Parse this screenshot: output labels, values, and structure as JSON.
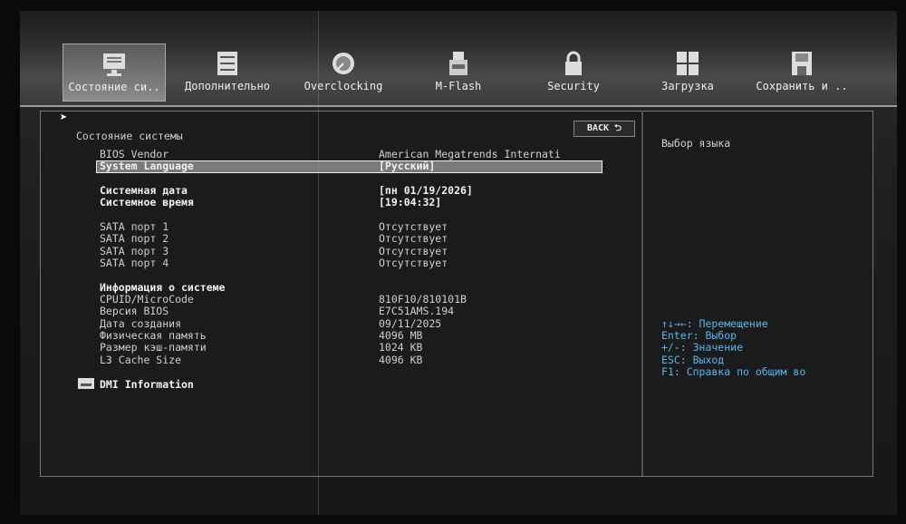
{
  "tabs": [
    {
      "label": "Состояние си..",
      "icon": "monitor-icon",
      "active": true
    },
    {
      "label": "Дополнительно",
      "icon": "settings-sliders-icon"
    },
    {
      "label": "Overclocking",
      "icon": "gauge-icon"
    },
    {
      "label": "M-Flash",
      "icon": "usb-flash-icon"
    },
    {
      "label": "Security",
      "icon": "lock-icon"
    },
    {
      "label": "Загрузка",
      "icon": "boot-icon"
    },
    {
      "label": "Сохранить и ..",
      "icon": "floppy-icon"
    }
  ],
  "main": {
    "title": "Состояние системы",
    "back_label": "BACK ⮌",
    "rows": [
      {
        "label": "BIOS Vendor",
        "value": "American Megatrends Internati"
      },
      {
        "label": "System Language",
        "value": "[Русский]"
      },
      {
        "label": "Системная дата",
        "value": "[пн 01/19/2026]"
      },
      {
        "label": "Системное время",
        "value": "[19:04:32]"
      },
      {
        "label": "SATA порт 1",
        "value": "Отсутствует"
      },
      {
        "label": "SATA порт 2",
        "value": "Отсутствует"
      },
      {
        "label": "SATA порт 3",
        "value": "Отсутствует"
      },
      {
        "label": "SATA порт 4",
        "value": "Отсутствует"
      },
      {
        "label": "Информация о системе",
        "value": ""
      },
      {
        "label": "CPUID/MicroCode",
        "value": "810F10/810101B"
      },
      {
        "label": "Версия BIOS",
        "value": "E7C51AMS.194"
      },
      {
        "label": "Дата создания",
        "value": "09/11/2025"
      },
      {
        "label": "Физическая память",
        "value": "4096 MB"
      },
      {
        "label": "Размер кэш-памяти",
        "value": "1024 KB"
      },
      {
        "label": "L3 Cache Size",
        "value": "4096 KB"
      }
    ],
    "dmi_label": "DMI Information"
  },
  "help": {
    "description": "Выбор языка",
    "keys": [
      "↑↓→←: Перемещение",
      "Enter: Выбор",
      "+/-: Значение",
      "ESC: Выход",
      "F1: Справка по общим во"
    ]
  }
}
